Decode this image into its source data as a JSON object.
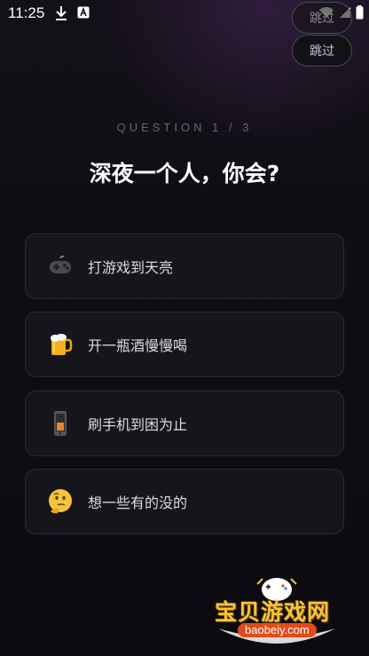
{
  "status_bar": {
    "time": "11:25"
  },
  "skip_label": "跳过",
  "progress_text": "QUESTION 1 / 3",
  "question": "深夜一个人，你会?",
  "options": [
    {
      "label": "打游戏到天亮",
      "icon": "game-controller-icon"
    },
    {
      "label": "开一瓶酒慢慢喝",
      "icon": "beer-mug-icon"
    },
    {
      "label": "刷手机到困为止",
      "icon": "mobile-phone-icon"
    },
    {
      "label": "想一些有的没的",
      "icon": "thinking-face-icon"
    }
  ],
  "watermark": {
    "title": "宝贝游戏网",
    "url": "baobeiy.com"
  },
  "colors": {
    "background": "#0e0e12",
    "card": "#15151a",
    "card_border": "#2a2a30",
    "watermark_gold": "#f6c33a"
  }
}
